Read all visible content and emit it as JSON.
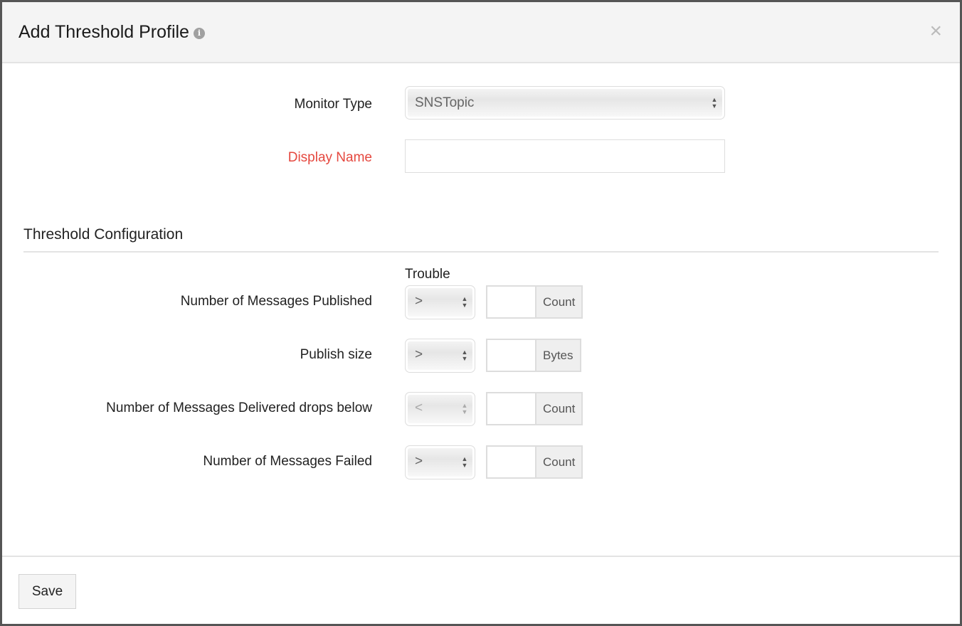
{
  "dialog": {
    "title": "Add Threshold Profile",
    "info_icon": "info-icon",
    "close_icon": "close-icon",
    "close_glyph": "×"
  },
  "form": {
    "monitor_type": {
      "label": "Monitor Type",
      "value": "SNSTopic"
    },
    "display_name": {
      "label": "Display Name",
      "value": "",
      "required_color": "#e5483f"
    }
  },
  "threshold": {
    "section_title": "Threshold Configuration",
    "column_header": "Trouble",
    "rows": [
      {
        "label": "Number of Messages Published",
        "operator": ">",
        "value": "",
        "unit": "Count",
        "disabled": false
      },
      {
        "label": "Publish size",
        "operator": ">",
        "value": "",
        "unit": "Bytes",
        "disabled": false
      },
      {
        "label": "Number of Messages Delivered drops below",
        "operator": "<",
        "value": "",
        "unit": "Count",
        "disabled": true
      },
      {
        "label": "Number of Messages Failed",
        "operator": ">",
        "value": "",
        "unit": "Count",
        "disabled": false
      }
    ]
  },
  "footer": {
    "save_label": "Save"
  }
}
